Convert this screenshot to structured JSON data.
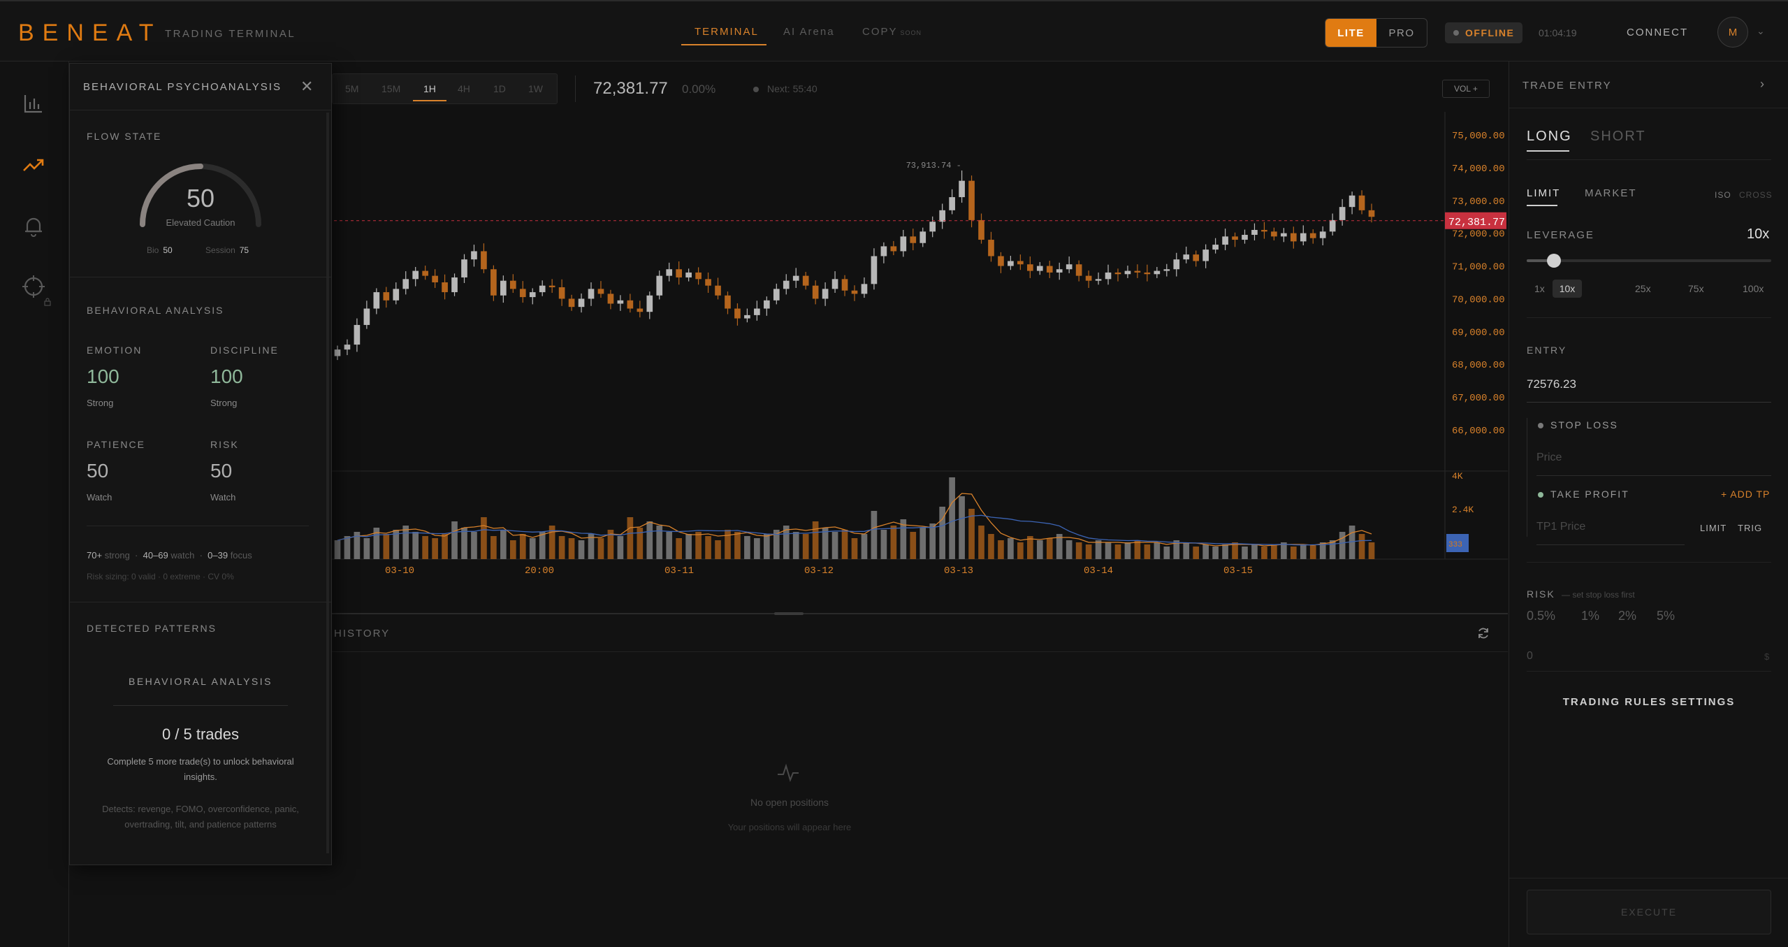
{
  "app": {
    "logo": "BENEAT",
    "subtitle": "TRADING TERMINAL"
  },
  "nav": {
    "tabs": [
      {
        "label": "TERMINAL",
        "active": true
      },
      {
        "label": "AI Arena",
        "active": false
      },
      {
        "label": "COPY",
        "badge": "SOON",
        "active": false
      }
    ]
  },
  "header": {
    "mode_lite": "LITE",
    "mode_pro": "PRO",
    "status": "OFFLINE",
    "clock": "01:04:19",
    "connect": "CONNECT",
    "avatar": "M"
  },
  "chart_toolbar": {
    "timeframes": [
      "5M",
      "15M",
      "1H",
      "4H",
      "1D",
      "1W"
    ],
    "active_timeframe": "1H",
    "price": "72,381.77",
    "change": "0.00%",
    "next": "Next: 55:40",
    "vol_button": "VOL +"
  },
  "chart_data": {
    "type": "candlestick",
    "price_axis_labels": [
      "75,000.00",
      "74,000.00",
      "73,000.00",
      "72,000.00",
      "71,000.00",
      "70,000.00",
      "69,000.00",
      "68,000.00",
      "67,000.00",
      "66,000.00"
    ],
    "price_axis_values": [
      75000,
      74000,
      73000,
      72000,
      71000,
      70000,
      69000,
      68000,
      67000,
      66000
    ],
    "current_price_label": "72,381.77",
    "current_price": 72381.77,
    "high_annotation": "73,913.74",
    "high_value": 73913.74,
    "x_tick_labels": [
      "03-10",
      "20:00",
      "03-11",
      "03-12",
      "03-13",
      "03-14",
      "03-15"
    ],
    "volume_axis_labels": [
      "4K",
      "2.4K"
    ],
    "volume_current_label": "333",
    "closes": [
      68450,
      68600,
      69200,
      69700,
      70200,
      69950,
      70300,
      70600,
      70850,
      70700,
      70500,
      70200,
      70650,
      71200,
      71450,
      70900,
      70100,
      70550,
      70300,
      70050,
      70200,
      70400,
      70350,
      70000,
      69750,
      70000,
      70300,
      70150,
      69850,
      69950,
      69700,
      69600,
      70100,
      70700,
      70900,
      70650,
      70800,
      70600,
      70400,
      70100,
      69700,
      69400,
      69500,
      69700,
      69950,
      70300,
      70550,
      70700,
      70400,
      70000,
      70300,
      70600,
      70250,
      70150,
      70450,
      71300,
      71600,
      71450,
      71900,
      71700,
      72050,
      72350,
      72700,
      73100,
      73600,
      72400,
      71800,
      71300,
      71000,
      71150,
      71050,
      70850,
      71000,
      70800,
      70900,
      71050,
      70700,
      70550,
      70600,
      70800,
      70750,
      70850,
      70800,
      70750,
      70850,
      70900,
      71200,
      71350,
      71150,
      71500,
      71650,
      71900,
      71800,
      71950,
      72100,
      72050,
      71900,
      72000,
      71750,
      72000,
      71850,
      72050,
      72400,
      72800,
      73150,
      72700,
      72500
    ],
    "volumes": [
      900,
      1100,
      1300,
      1000,
      1500,
      1200,
      1400,
      1600,
      1300,
      1100,
      1000,
      1200,
      1800,
      1500,
      1300,
      2000,
      1100,
      1400,
      900,
      1200,
      1000,
      1300,
      1600,
      1100,
      1000,
      900,
      1200,
      1000,
      1400,
      1100,
      2000,
      1500,
      1800,
      1600,
      1300,
      1000,
      1200,
      1300,
      1100,
      900,
      1400,
      1300,
      1100,
      1000,
      1200,
      1400,
      1600,
      1300,
      1200,
      1800,
      1500,
      1300,
      1400,
      1000,
      1200,
      2300,
      1400,
      1600,
      1900,
      1300,
      1500,
      1700,
      2500,
      3900,
      3000,
      2400,
      1600,
      1200,
      900,
      1000,
      800,
      1100,
      900,
      1000,
      1200,
      900,
      800,
      700,
      900,
      800,
      700,
      800,
      900,
      700,
      800,
      600,
      900,
      800,
      600,
      700,
      600,
      700,
      800,
      600,
      700,
      600,
      700,
      800,
      600,
      700,
      700,
      800,
      900,
      1300,
      1600,
      1200,
      800
    ]
  },
  "behavioral_panel": {
    "title": "BEHAVIORAL PSYCHOANALYSIS",
    "flow_state_label": "FLOW STATE",
    "flow_value": "50",
    "flow_level": 50,
    "flow_caption": "Elevated Caution",
    "bio_label": "Bio",
    "bio_value": "50",
    "session_label": "Session",
    "session_value": "75",
    "analysis_label": "BEHAVIORAL ANALYSIS",
    "metrics": [
      {
        "label": "EMOTION",
        "value": "100",
        "status": "Strong"
      },
      {
        "label": "DISCIPLINE",
        "value": "100",
        "status": "Strong"
      },
      {
        "label": "PATIENCE",
        "value": "50",
        "status": "Watch"
      },
      {
        "label": "RISK",
        "value": "50",
        "status": "Watch"
      }
    ],
    "legend": {
      "strong_range": "70+",
      "strong": "strong",
      "watch_range": "40–69",
      "watch": "watch",
      "focus_range": "0–39",
      "focus": "focus"
    },
    "risk_sizing": "Risk sizing: 0 valid · 0 extreme · CV 0%",
    "patterns_label": "DETECTED PATTERNS",
    "patterns_title": "BEHAVIORAL ANALYSIS",
    "trades": "0 / 5 trades",
    "unlock_text": "Complete 5 more trade(s) to unlock behavioral insights.",
    "detects_text": "Detects: revenge, FOMO, overconfidence, panic, overtrading, tilt, and patience patterns"
  },
  "positions": {
    "history_tab": "HISTORY",
    "empty_title": "No open positions",
    "empty_sub": "Your positions will appear here"
  },
  "trade_panel": {
    "title": "TRADE ENTRY",
    "long": "LONG",
    "short": "SHORT",
    "limit": "LIMIT",
    "market": "MARKET",
    "iso": "ISO",
    "cross": "CROSS",
    "leverage_label": "LEVERAGE",
    "leverage_value": "10x",
    "leverage_options": [
      "1x",
      "10x",
      "25x",
      "75x",
      "100x"
    ],
    "leverage_selected": "10x",
    "entry_label": "ENTRY",
    "entry_value": "72576.23",
    "stop_loss_label": "STOP LOSS",
    "stop_loss_placeholder": "Price",
    "take_profit_label": "TAKE PROFIT",
    "add_tp": "+ ADD TP",
    "tp1_placeholder": "TP1 Price",
    "tp_limit": "LIMIT",
    "tp_trig": "TRIG",
    "risk_label": "RISK",
    "risk_hint": "— set stop loss first",
    "risk_options": [
      "0.5%",
      "1%",
      "2%",
      "5%"
    ],
    "risk_amount": "0",
    "risk_unit": "$",
    "rules_button": "TRADING RULES SETTINGS",
    "execute": "EXECUTE"
  },
  "colors": {
    "accent": "#e07b12",
    "bull": "#b8b8b8",
    "bear": "#b5651d",
    "price_tag": "#c8313f",
    "metric_green": "#8fb89a"
  }
}
